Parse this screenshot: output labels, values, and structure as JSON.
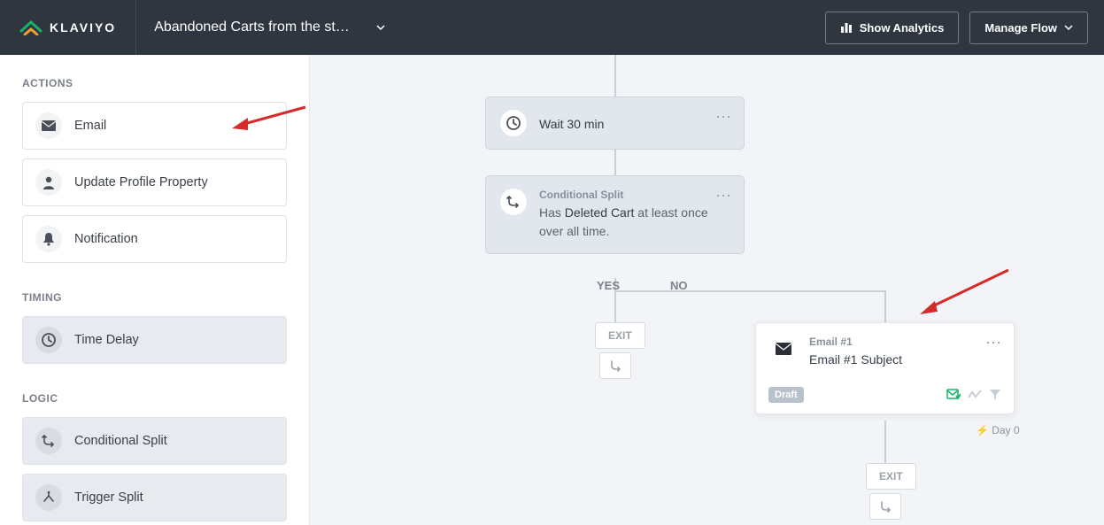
{
  "header": {
    "brand": "KLAVIYO",
    "flow_title": "Abandoned Carts from the st…",
    "show_analytics": "Show Analytics",
    "manage_flow": "Manage Flow"
  },
  "sidebar": {
    "sections": {
      "actions": {
        "title": "ACTIONS",
        "items": {
          "email": "Email",
          "update_profile": "Update Profile Property",
          "notification": "Notification"
        }
      },
      "timing": {
        "title": "TIMING",
        "items": {
          "time_delay": "Time Delay"
        }
      },
      "logic": {
        "title": "LOGIC",
        "items": {
          "conditional_split": "Conditional Split",
          "trigger_split": "Trigger Split"
        }
      }
    }
  },
  "canvas": {
    "wait_node": {
      "text": "Wait 30 min"
    },
    "split_node": {
      "eyebrow": "Conditional Split",
      "line_pre": "Has ",
      "line_mid": "Deleted Cart",
      "line_post": " at least once over all time."
    },
    "path_yes": "YES",
    "path_no": "NO",
    "exit_label": "EXIT",
    "email_node": {
      "eyebrow": "Email #1",
      "subject": "Email #1 Subject",
      "draft_badge": "Draft"
    },
    "day_label": "Day 0"
  }
}
